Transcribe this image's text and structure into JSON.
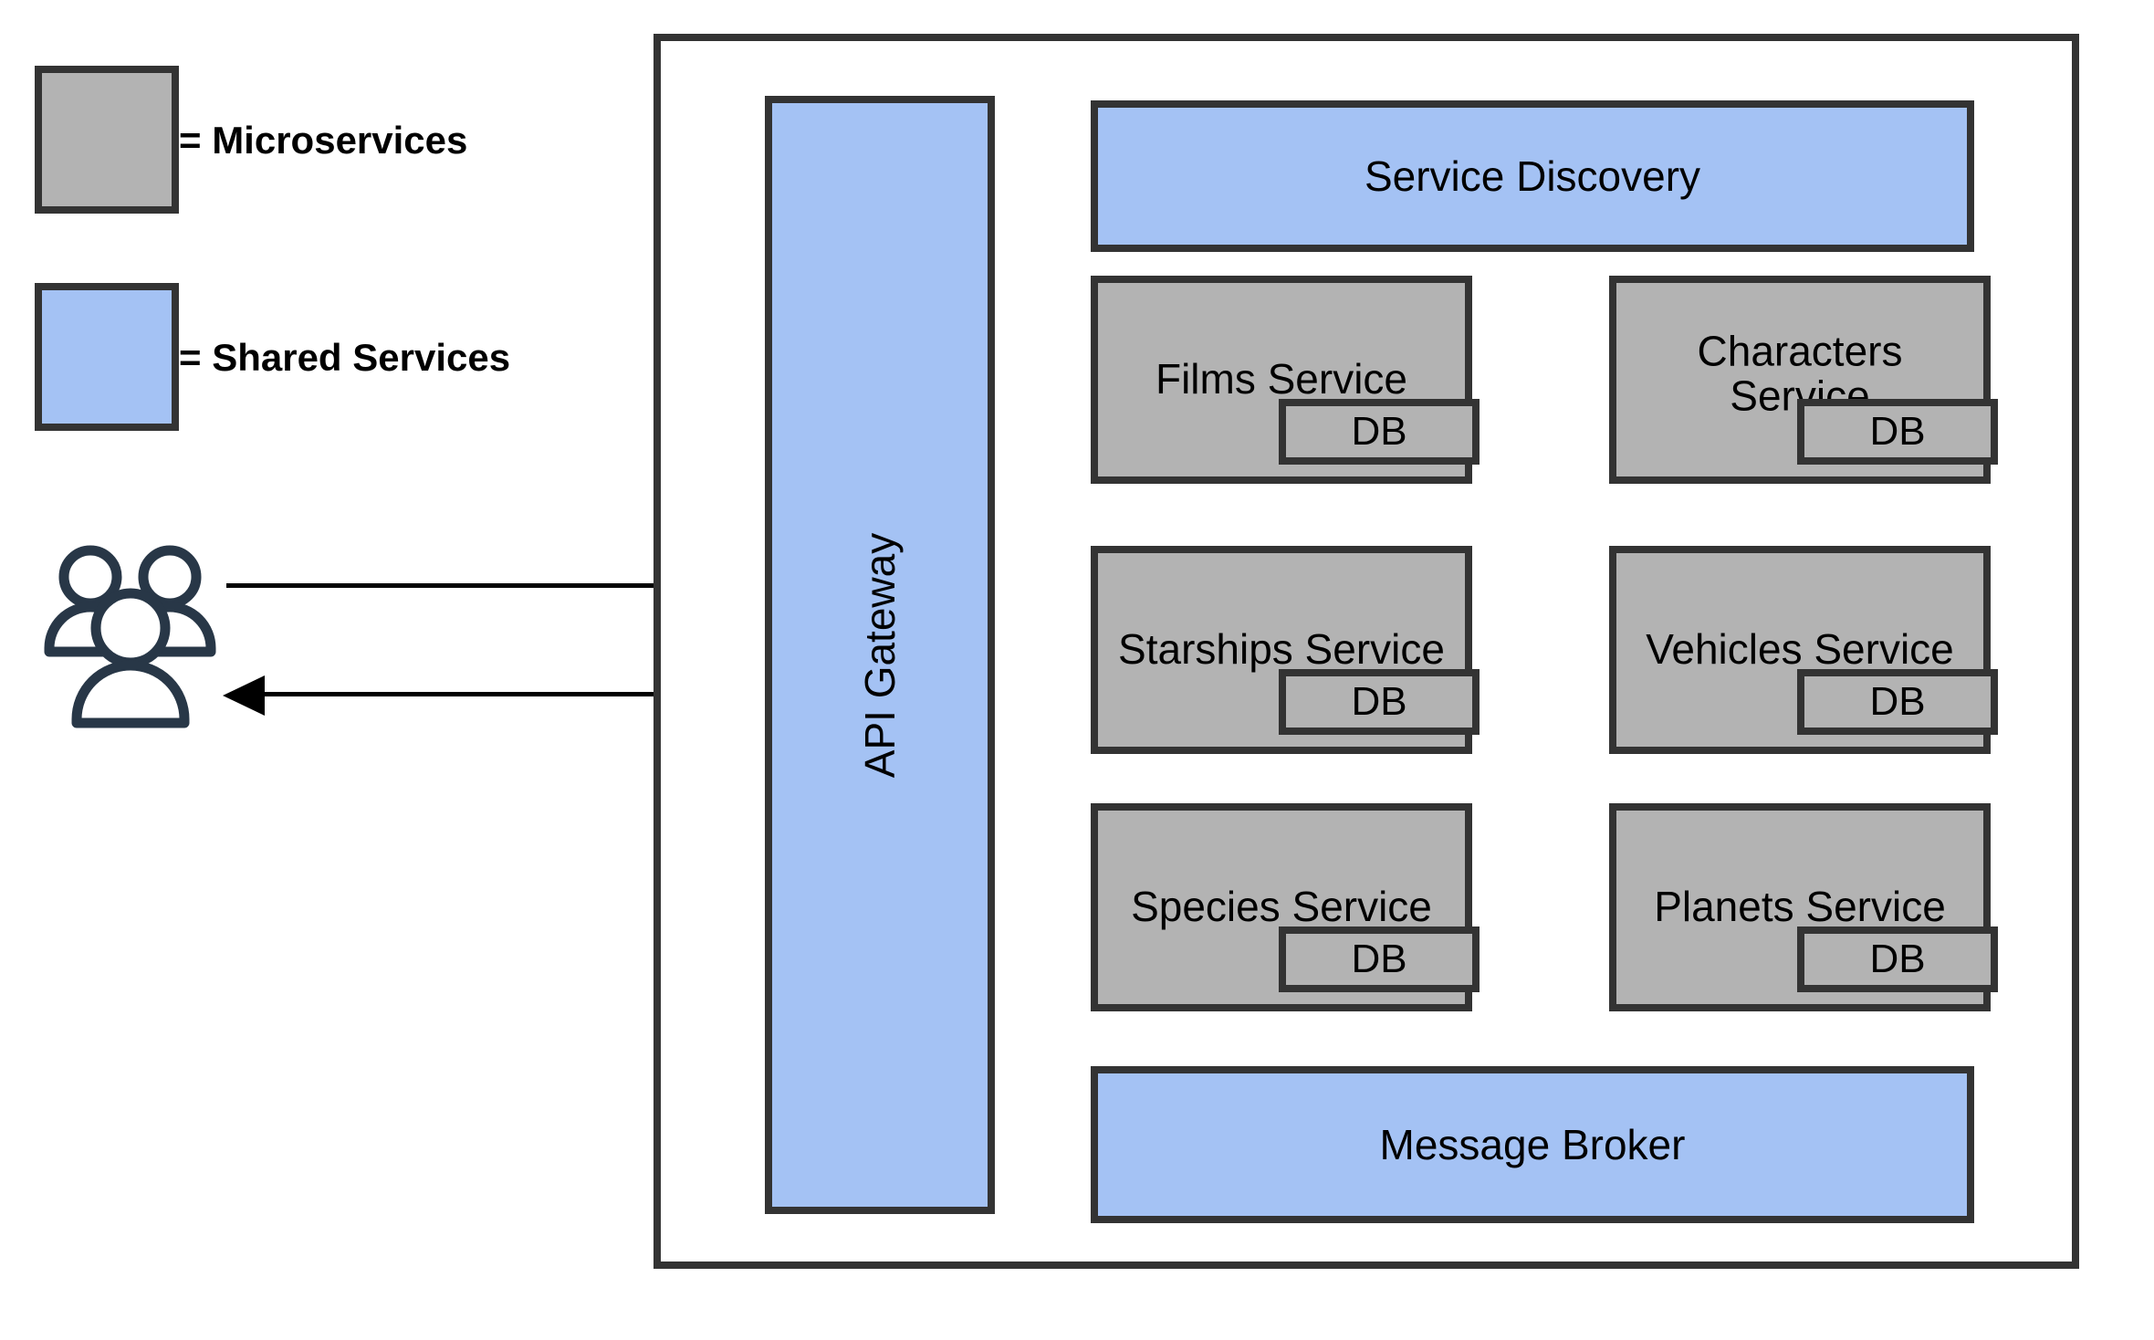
{
  "legend": {
    "items": [
      {
        "name": "microservices",
        "label": "= Microservices",
        "color": "#b3b3b3"
      },
      {
        "name": "shared-services",
        "label": "= Shared Services",
        "color": "#a4c2f4"
      }
    ]
  },
  "actor": {
    "icon": "users-icon",
    "color": "#283747"
  },
  "arrows": [
    {
      "name": "request-arrow",
      "direction": "right",
      "from": "users",
      "to": "api-gateway"
    },
    {
      "name": "response-arrow",
      "direction": "left",
      "from": "api-gateway",
      "to": "users"
    }
  ],
  "gateway": {
    "label": "API Gateway",
    "color": "#a4c2f4"
  },
  "shared_services": {
    "top": {
      "label": "Service Discovery",
      "color": "#a4c2f4"
    },
    "bottom": {
      "label": "Message Broker",
      "color": "#a4c2f4"
    }
  },
  "db_label": "DB",
  "microservices": [
    {
      "name": "films-service",
      "label": "Films Service",
      "db": "DB",
      "lines": 1
    },
    {
      "name": "characters-service",
      "label": "Characters Service",
      "db": "DB",
      "lines": 2
    },
    {
      "name": "starships-service",
      "label": "Starships Service",
      "db": "DB",
      "lines": 1
    },
    {
      "name": "vehicles-service",
      "label": "Vehicles Service",
      "db": "DB",
      "lines": 1
    },
    {
      "name": "species-service",
      "label": "Species Service",
      "db": "DB",
      "lines": 1
    },
    {
      "name": "planets-service",
      "label": "Planets Service",
      "db": "DB",
      "lines": 1
    }
  ],
  "colors": {
    "microservice_fill": "#b3b3b3",
    "shared_fill": "#a4c2f4",
    "stroke": "#333333",
    "actor_stroke": "#283747",
    "background": "#ffffff"
  }
}
